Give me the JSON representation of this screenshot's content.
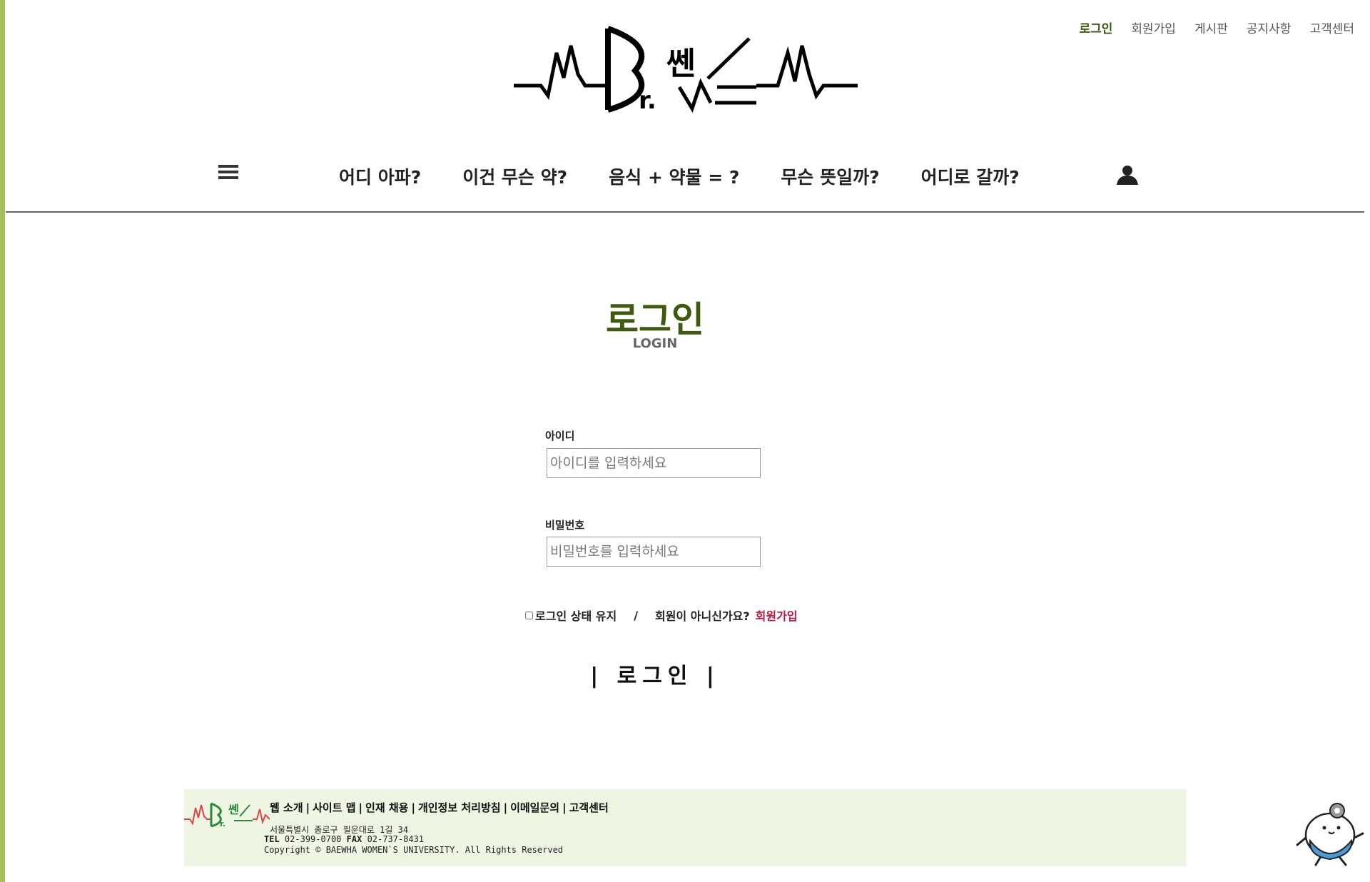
{
  "top_links": [
    {
      "label": "로그인",
      "active": true
    },
    {
      "label": "회원가입",
      "active": false
    },
    {
      "label": "게시판",
      "active": false
    },
    {
      "label": "공지사항",
      "active": false
    },
    {
      "label": "고객센터",
      "active": false
    }
  ],
  "nav": {
    "items": [
      "어디 아파?",
      "이건 무슨 약?",
      "음식 + 약물 = ?",
      "무슨 뜻일까?",
      "어디로 갈까?"
    ],
    "menu_icon": "hamburger-icon",
    "user_icon": "user-icon"
  },
  "page": {
    "title": "로그인",
    "subtitle": "LOGIN"
  },
  "form": {
    "id_label": "아이디",
    "id_placeholder": "아이디를 입력하세요",
    "password_label": "비밀번호",
    "password_placeholder": "비밀번호를 입력하세요",
    "keep_login": "로그인 상태 유지",
    "separator": "/",
    "not_member": "회원이 아니신가요?",
    "signup": "회원가입",
    "submit": "| 로그인 |"
  },
  "footer": {
    "links": [
      "웹 소개",
      "사이트 맵",
      "인재 채용",
      "개인정보 처리방침",
      "이메일문의",
      "고객센터"
    ],
    "address": "서울특별시 종로구 필운대로 1길 34",
    "tel_label": "TEL",
    "tel": "02-399-0700",
    "fax_label": "FAX",
    "fax": "02-737-8431",
    "copyright": "Copyright © BAEWHA WOMEN`S UNIVERSITY. All Rights Reserved"
  },
  "colors": {
    "accent": "#3d5a0f",
    "stripe": "#a4bf5b",
    "signup": "#c0143c",
    "footer_bg": "#eef5e2"
  }
}
